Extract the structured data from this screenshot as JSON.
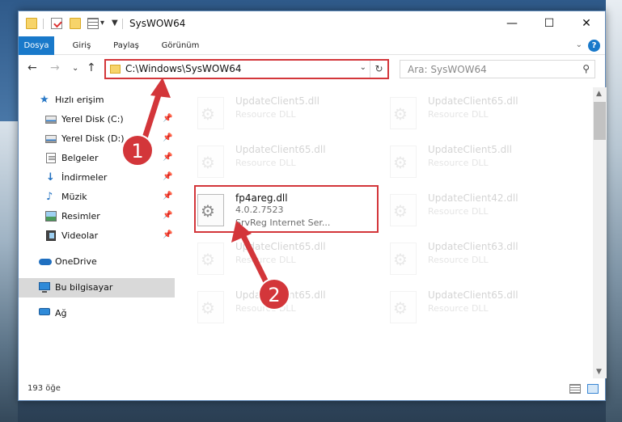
{
  "window": {
    "title": "SysWOW64",
    "controls": {
      "minimize": "—",
      "maximize": "☐",
      "close": "✕"
    }
  },
  "ribbon": {
    "tabs": [
      "Dosya",
      "Giriş",
      "Paylaş",
      "Görünüm"
    ],
    "help": "?"
  },
  "address_bar": {
    "path": "C:\\Windows\\SysWOW64",
    "search_placeholder": "Ara: SysWOW64"
  },
  "sidebar": {
    "items": [
      {
        "label": "Hızlı erişim",
        "icon": "star-icon"
      },
      {
        "label": "Yerel Disk (C:)",
        "icon": "drive-icon",
        "pinned": true
      },
      {
        "label": "Yerel Disk (D:)",
        "icon": "drive-icon",
        "pinned": true
      },
      {
        "label": "Belgeler",
        "icon": "documents-icon",
        "pinned": true
      },
      {
        "label": "İndirmeler",
        "icon": "download-icon",
        "pinned": true
      },
      {
        "label": "Müzik",
        "icon": "music-icon",
        "pinned": true
      },
      {
        "label": "Resimler",
        "icon": "pictures-icon",
        "pinned": true
      },
      {
        "label": "Videolar",
        "icon": "videos-icon",
        "pinned": true
      },
      {
        "label": "OneDrive",
        "icon": "cloud-icon"
      },
      {
        "label": "Bu bilgisayar",
        "icon": "computer-icon",
        "selected": true
      },
      {
        "label": "Ağ",
        "icon": "network-icon"
      }
    ]
  },
  "files": [
    {
      "name": "UpdateClient5.dll",
      "type": "Resource DLL",
      "faded": true
    },
    {
      "name": "UpdateClient65.dll",
      "type": "Resource DLL",
      "faded": true
    },
    {
      "name": "UpdateClient65.dll",
      "type": "Resource DLL",
      "faded": true
    },
    {
      "name": "UpdateClient5.dll",
      "type": "Resource DLL",
      "faded": true
    },
    {
      "name": "fp4areg.dll",
      "version": "4.0.2.7523",
      "type": "SrvReg Internet Ser...",
      "faded": false,
      "highlighted": true
    },
    {
      "name": "UpdateClient42.dll",
      "type": "Resource DLL",
      "faded": true
    },
    {
      "name": "UpdateClient65.dll",
      "type": "Resource DLL",
      "faded": true
    },
    {
      "name": "UpdateClient63.dll",
      "type": "Resource DLL",
      "faded": true
    },
    {
      "name": "UpdateClient65.dll",
      "type": "Resource DLL",
      "faded": true
    },
    {
      "name": "UpdateClient65.dll",
      "type": "Resource DLL",
      "faded": true
    }
  ],
  "status": {
    "item_count": "193 öğe"
  },
  "annotations": {
    "step1": "1",
    "step2": "2",
    "color": "#d3363a"
  }
}
